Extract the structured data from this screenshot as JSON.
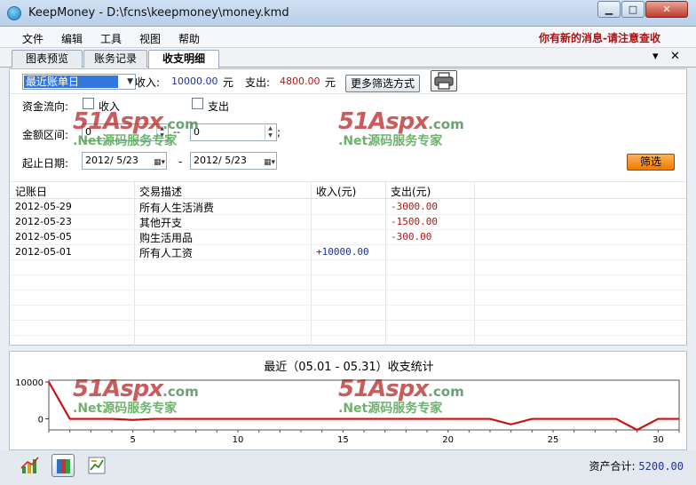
{
  "window": {
    "title": "KeepMoney - D:\\fcns\\keepmoney\\money.kmd",
    "minimize": "▁",
    "maximize": "□",
    "close": "✕"
  },
  "menu": {
    "items": [
      "文件",
      "编辑",
      "工具",
      "视图",
      "帮助"
    ],
    "notice": "你有新的消息-请注意查收"
  },
  "tabs": {
    "items": [
      "图表预览",
      "账务记录",
      "收支明细"
    ],
    "active": "收支明细",
    "pin": "▾",
    "close": "✕"
  },
  "filterbar": {
    "period": "最近账单日",
    "income_label": "收入:",
    "income_value": "10000.00",
    "income_unit": "元",
    "expense_label": "支出:",
    "expense_value": "4800.00",
    "expense_unit": "元",
    "more_filters": "更多筛选方式"
  },
  "filters": {
    "flow_label": "资金流向:",
    "income_check": "收入",
    "expense_check": "支出",
    "amount_label": "金额区间:",
    "amount_from": "0",
    "amount_sep": "--",
    "amount_to": "0",
    "amount_end": ";",
    "date_label": "起止日期:",
    "date_from": "2012/ 5/23",
    "date_sep": "-",
    "date_to": "2012/ 5/23",
    "filter_button": "筛选"
  },
  "table": {
    "columns": [
      "记账日",
      "交易描述",
      "收入(元)",
      "支出(元)"
    ],
    "rows": [
      {
        "date": "2012-05-29",
        "desc": "所有人生活消费",
        "income": "",
        "expense": "-3000.00"
      },
      {
        "date": "2012-05-23",
        "desc": "其他开支",
        "income": "",
        "expense": "-1500.00"
      },
      {
        "date": "2012-05-05",
        "desc": "购生活用品",
        "income": "",
        "expense": "-300.00"
      },
      {
        "date": "2012-05-01",
        "desc": "所有人工资",
        "income": "+10000.00",
        "expense": ""
      }
    ]
  },
  "chart_data": {
    "type": "line",
    "title": "最近（05.01 - 05.31）收支统计",
    "x": [
      1,
      2,
      3,
      4,
      5,
      6,
      7,
      8,
      9,
      10,
      11,
      12,
      13,
      14,
      15,
      16,
      17,
      18,
      19,
      20,
      21,
      22,
      23,
      24,
      25,
      26,
      27,
      28,
      29,
      30,
      31
    ],
    "series": [
      {
        "values": [
          10000,
          0,
          0,
          0,
          -300,
          0,
          0,
          0,
          0,
          0,
          0,
          0,
          0,
          0,
          0,
          0,
          0,
          0,
          0,
          0,
          0,
          0,
          -1500,
          0,
          0,
          0,
          0,
          0,
          -3000,
          0,
          0
        ]
      }
    ],
    "xlim": [
      1,
      31
    ],
    "ylim": [
      -3000,
      10000
    ],
    "xticks": [
      5,
      10,
      15,
      20,
      25,
      30
    ],
    "yticks": [
      0,
      10000
    ],
    "line_color": "#cc1111"
  },
  "status": {
    "assets_label": "资产合计:",
    "assets_value": "5200.00"
  },
  "watermark": {
    "brand": "51Aspx",
    "domain": ".com",
    "tagline": ".Net源码服务专家"
  }
}
